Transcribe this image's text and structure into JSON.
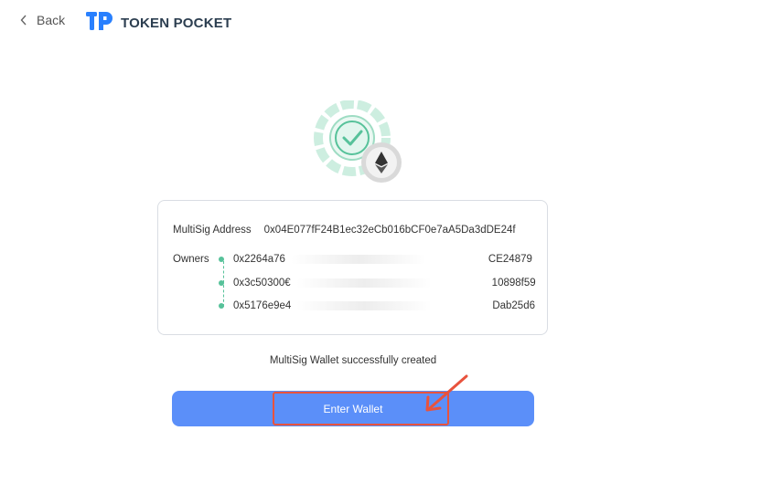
{
  "header": {
    "back_label": "Back",
    "logo_text": "TOKEN POCKET",
    "logo_mark": "TP"
  },
  "card": {
    "address_label": "MultiSig Address",
    "address_value": "0x04E077fF24B1ec32eCb016bCF0e7aA5Da3dDE24f",
    "owners_label": "Owners",
    "owners": [
      {
        "prefix": "0x2264a76",
        "suffix": "CE24879"
      },
      {
        "prefix": "0x3c50300€",
        "suffix": "10898f59"
      },
      {
        "prefix": "0x5176e9e4",
        "suffix": "Dab25d6"
      }
    ]
  },
  "status_text": "MultiSig Wallet successfully created",
  "enter_button_label": "Enter Wallet",
  "colors": {
    "accent": "#5b8ff9",
    "success": "#57c29a",
    "highlight": "#e8533d"
  },
  "icons": {
    "back": "chevron-left-icon",
    "success": "check-circle-icon",
    "network": "ethereum-icon"
  }
}
